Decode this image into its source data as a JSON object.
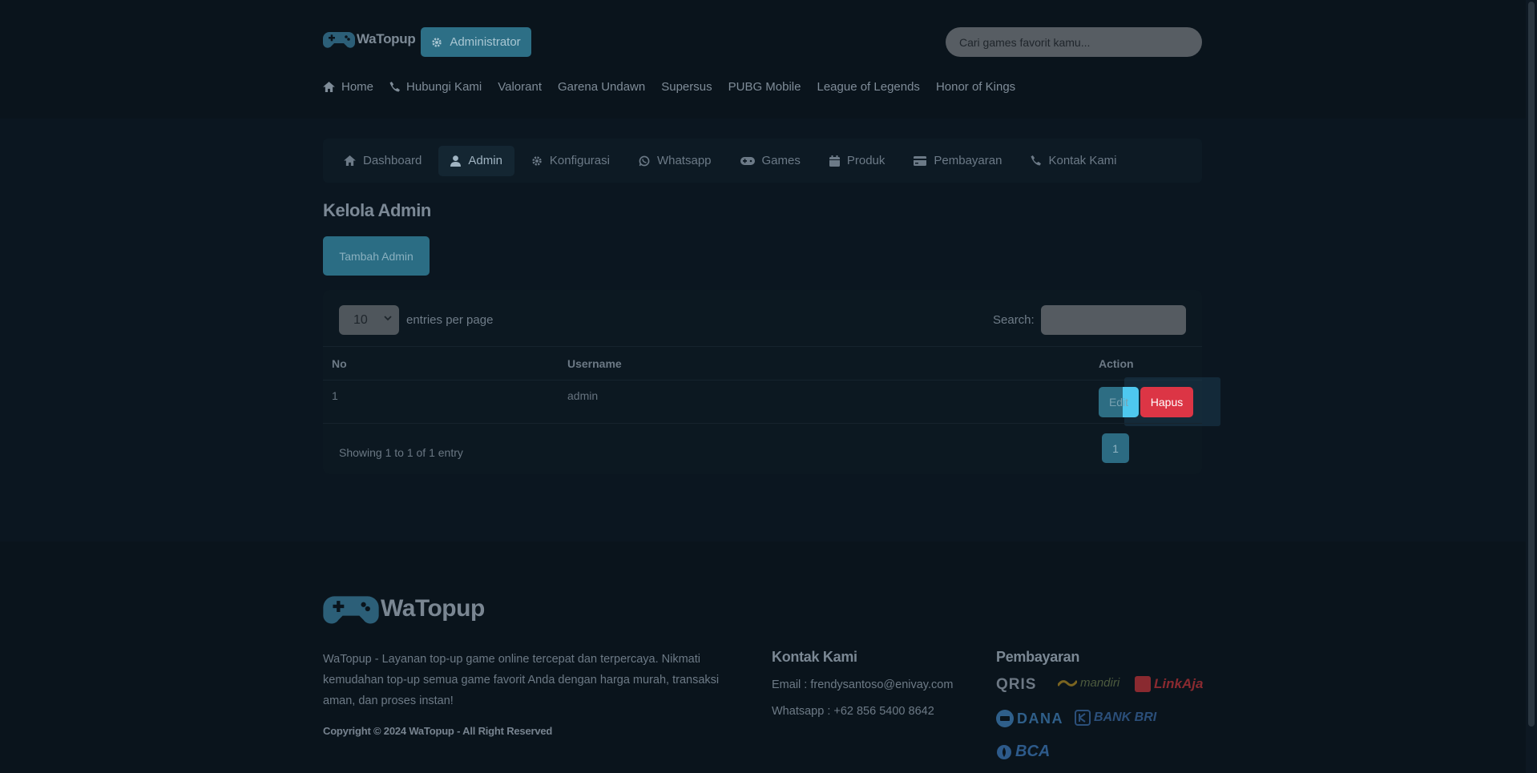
{
  "header": {
    "brand": "WaTopup",
    "admin_badge": "Administrator",
    "search_placeholder": "Cari games favorit kamu...",
    "nav": [
      {
        "label": "Home",
        "icon": "home-icon"
      },
      {
        "label": "Hubungi Kami",
        "icon": "phone-icon"
      },
      {
        "label": "Valorant"
      },
      {
        "label": "Garena Undawn"
      },
      {
        "label": "Supersus"
      },
      {
        "label": "PUBG Mobile"
      },
      {
        "label": "League of Legends"
      },
      {
        "label": "Honor of Kings"
      }
    ]
  },
  "panel_nav": [
    {
      "label": "Dashboard",
      "icon": "home-icon"
    },
    {
      "label": "Admin",
      "icon": "user-icon",
      "active": true
    },
    {
      "label": "Konfigurasi",
      "icon": "gear-icon"
    },
    {
      "label": "Whatsapp",
      "icon": "whatsapp-icon"
    },
    {
      "label": "Games",
      "icon": "gamepad-icon"
    },
    {
      "label": "Produk",
      "icon": "calendar-icon"
    },
    {
      "label": "Pembayaran",
      "icon": "credit-card-icon"
    },
    {
      "label": "Kontak Kami",
      "icon": "phone-icon"
    }
  ],
  "main": {
    "title": "Kelola Admin",
    "add_button": "Tambah Admin",
    "table": {
      "page_length": "10",
      "page_length_label": "entries per page",
      "search_label": "Search:",
      "columns": [
        "No",
        "Username",
        "Action"
      ],
      "rows": [
        {
          "no": "1",
          "username": "admin",
          "edit": "Edit",
          "delete": "Hapus"
        }
      ],
      "info": "Showing 1 to 1 of 1 entry",
      "current_page": "1"
    }
  },
  "footer": {
    "brand": "WaTopup",
    "description": "WaTopup - Layanan top-up game online tercepat dan terpercaya. Nikmati kemudahan top-up semua game favorit Anda dengan harga murah, transaksi aman, dan proses instan!",
    "copyright": "Copyright © 2024 WaTopup - All Right Reserved",
    "contact_title": "Kontak Kami",
    "email": "Email : frendysantoso@enivay.com",
    "whatsapp": "Whatsapp : +62 856 5400 8642",
    "payment_title": "Pembayaran",
    "payments": [
      "QRIS",
      "mandiri",
      "LinkAja",
      "DANA",
      "BANK BRI",
      "BCA"
    ]
  },
  "colors": {
    "background": "#0b1620",
    "accent": "#2d6f86",
    "danger": "#dc3545",
    "highlight": "#4ec8ef"
  }
}
